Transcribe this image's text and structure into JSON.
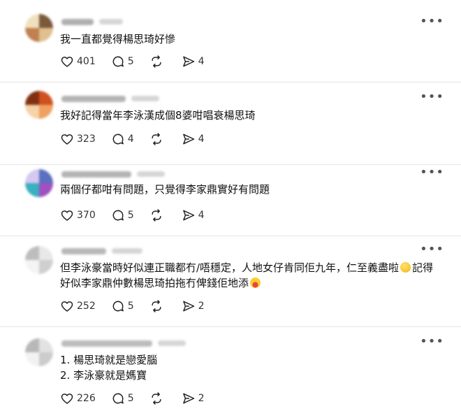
{
  "posts": [
    {
      "text_lines": [
        "我一直都覺得楊思琦好慘"
      ],
      "likes": "401",
      "replies": "5",
      "reposts": "",
      "shares": "4",
      "avatar_colors": [
        "#7a5a3a",
        "#e0c090",
        "#c08050",
        "#f0e0c0"
      ]
    },
    {
      "text_lines": [
        "我好記得當年李泳漢成個8婆咁唱衰楊思琦"
      ],
      "likes": "323",
      "replies": "4",
      "reposts": "",
      "shares": "4",
      "avatar_colors": [
        "#d05020",
        "#f0a060",
        "#f6d2a8",
        "#803010"
      ]
    },
    {
      "text_lines": [
        "兩個仔都咁有問題，只覺得李家鼎實好有問題"
      ],
      "likes": "370",
      "replies": "5",
      "reposts": "",
      "shares": "4",
      "avatar_colors": [
        "#5a70c0",
        "#a050c0",
        "#3ab0c0",
        "#d6c8f0"
      ]
    },
    {
      "text_lines": [
        "但李泳豪當時好似連正職都冇/唔穩定，人地女仔肯同佢九年，仁至義盡啦",
        "好似李家鼎仲數楊思琦拍拖冇俾錢佢地添"
      ],
      "inline_after_line1": "記得",
      "likes": "252",
      "replies": "5",
      "reposts": "",
      "shares": "2",
      "avatar_colors": [
        "#e8e8e8",
        "#cfcfcf",
        "#f4f4f4",
        "#bdbdbd"
      ]
    },
    {
      "text_lines": [
        "1. 楊思琦就是戀愛腦",
        "2. 李泳豪就是媽寶"
      ],
      "likes": "226",
      "replies": "5",
      "reposts": "",
      "shares": "2",
      "avatar_colors": [
        "#e2e2e2",
        "#cccccc",
        "#f2f2f2",
        "#b8b8b8"
      ]
    }
  ],
  "menu_label": "•••"
}
